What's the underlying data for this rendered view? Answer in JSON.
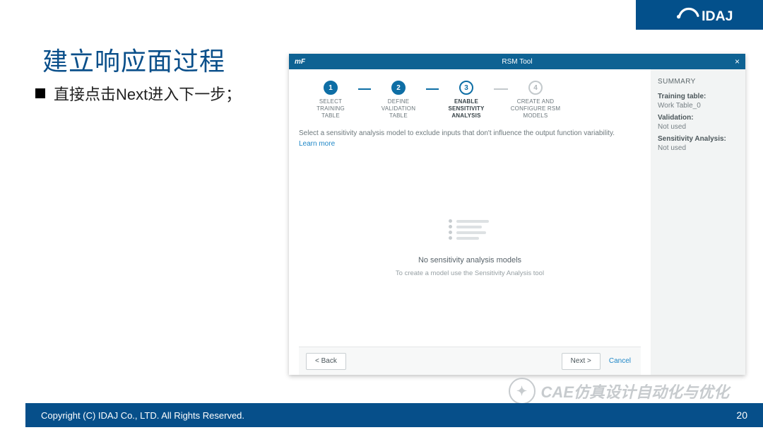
{
  "brand": {
    "name": "IDAJ"
  },
  "title": "建立响应面过程",
  "bullet": "直接点击Next进入下一步；",
  "app": {
    "mf": "mF",
    "title": "RSM Tool",
    "steps": [
      {
        "num": "1",
        "label": "SELECT\nTRAINING\nTABLE"
      },
      {
        "num": "2",
        "label": "DEFINE\nVALIDATION\nTABLE"
      },
      {
        "num": "3",
        "label": "ENABLE\nSENSITIVITY\nANALYSIS"
      },
      {
        "num": "4",
        "label": "CREATE AND\nCONFIGURE RSM\nMODELS"
      }
    ],
    "instruction": "Select a sensitivity analysis model to exclude inputs that don't influence the output function variability.",
    "learn_more": "Learn more",
    "empty_title": "No sensitivity analysis models",
    "empty_sub": "To create a model use the Sensitivity Analysis tool",
    "back": "<  Back",
    "next": "Next  >",
    "cancel": "Cancel",
    "summary": {
      "heading": "SUMMARY",
      "k1": "Training table:",
      "v1": "Work Table_0",
      "k2": "Validation:",
      "v2": "Not used",
      "k3": "Sensitivity Analysis:",
      "v3": "Not used"
    }
  },
  "watermark": "CAE仿真设计自动化与优化",
  "footer": {
    "copyright": "Copyright (C)  IDAJ Co., LTD. All Rights Reserved.",
    "page": "20"
  }
}
